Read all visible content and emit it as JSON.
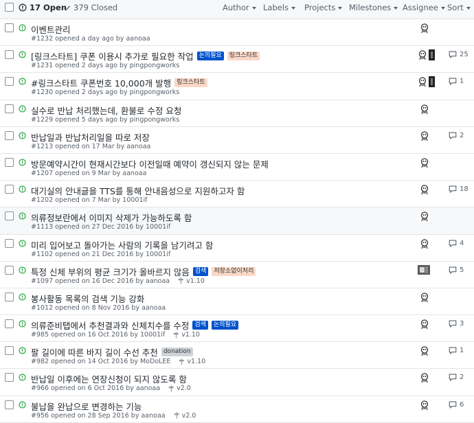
{
  "header": {
    "open_label": "17 Open",
    "closed_label": "379 Closed",
    "filters": [
      "Author",
      "Labels",
      "Projects",
      "Milestones",
      "Assignee",
      "Sort"
    ]
  },
  "colors": {
    "open_icon": "#28a745",
    "label_blue": "#0052cc",
    "label_peach": "#fad8c7",
    "label_gray": "#cfd3d7"
  },
  "issues": [
    {
      "title": "이벤트관리",
      "meta": "#1232 opened a day ago by aanoaa",
      "labels": [],
      "milestone": "",
      "comments": "",
      "avatar": "single"
    },
    {
      "title": "[링크스타트] 쿠폰 이용시 추가로 필요한 작업",
      "meta": "#1231 opened 2 days ago by pingpongworks",
      "labels": [
        {
          "text": "논의필요",
          "style": "blue"
        },
        {
          "text": "링크스타트",
          "style": "peach"
        }
      ],
      "milestone": "",
      "comments": "25",
      "avatar": "double"
    },
    {
      "title": "#링크스타트 쿠폰번호 10,000개 발행",
      "meta": "#1230 opened 2 days ago by pingpongworks",
      "labels": [
        {
          "text": "링크스타트",
          "style": "peach"
        }
      ],
      "milestone": "",
      "comments": "1",
      "avatar": "double"
    },
    {
      "title": "실수로 반납 처리했는데, 환불로 수정 요청",
      "meta": "#1229 opened 5 days ago by pingpongworks",
      "labels": [],
      "milestone": "",
      "comments": "",
      "avatar": "single"
    },
    {
      "title": "반납일과 반납처리일을 따로 저장",
      "meta": "#1213 opened on 17 Mar by aanoaa",
      "labels": [],
      "milestone": "",
      "comments": "2",
      "avatar": "single"
    },
    {
      "title": "방문예약시간이 현재시간보다 이전일때 예약이 갱신되지 않는 문제",
      "meta": "#1207 opened on 9 Mar by aanoaa",
      "labels": [],
      "milestone": "",
      "comments": "",
      "avatar": "single"
    },
    {
      "title": "대기실의 안내글을 TTS를 통해 안내음성으로 지원하고자 함",
      "meta": "#1202 opened on 7 Mar by 10001if",
      "labels": [],
      "milestone": "",
      "comments": "18",
      "avatar": "single"
    },
    {
      "title": "의류정보란에서 이미지 삭제가 가능하도록 함",
      "meta": "#1113 opened on 27 Dec 2016 by 10001if",
      "labels": [],
      "milestone": "",
      "comments": "",
      "avatar": "single"
    },
    {
      "title": "미리 입어보고 돌아가는 사람의 기록을 남기려고 함",
      "meta": "#1102 opened on 21 Dec 2016 by 10001if",
      "labels": [],
      "milestone": "",
      "comments": "4",
      "avatar": "single"
    },
    {
      "title": "특정 신체 부위의 평균 크기가 올바르지 않음",
      "meta": "#1097 opened on 16 Dec 2016 by aanoaa",
      "labels": [
        {
          "text": "검색",
          "style": "blue"
        },
        {
          "text": "저장소없이처리",
          "style": "peach"
        }
      ],
      "milestone": "v1.10",
      "comments": "5",
      "avatar": "big"
    },
    {
      "title": "봉사활동 목록의 검색 기능 강화",
      "meta": "#1012 opened on 8 Nov 2016 by aanoaa",
      "labels": [],
      "milestone": "",
      "comments": "",
      "avatar": "single"
    },
    {
      "title": "의류준비탭에서 추천결과와 신체치수를 수정",
      "meta": "#985 opened on 16 Oct 2016 by 10001if",
      "labels": [
        {
          "text": "검색",
          "style": "blue"
        },
        {
          "text": "논의필요",
          "style": "blue"
        }
      ],
      "milestone": "v1.10",
      "comments": "3",
      "avatar": "single"
    },
    {
      "title": "팔 길이에 따른 바지 길이 수선 추천",
      "meta": "#982 opened on 14 Oct 2016 by MoDoLEE",
      "labels": [
        {
          "text": "donation",
          "style": "gray"
        }
      ],
      "milestone": "v1.10",
      "comments": "1",
      "avatar": "single"
    },
    {
      "title": "반납일 이후에는 연장신청이 되지 않도록 함",
      "meta": "#966 opened on 6 Oct 2016 by aanoaa",
      "labels": [],
      "milestone": "v2.0",
      "comments": "2",
      "avatar": "single"
    },
    {
      "title": "불납을 완납으로 변경하는 기능",
      "meta": "#956 opened on 28 Sep 2016 by aanoaa",
      "labels": [],
      "milestone": "v2.0",
      "comments": "6",
      "avatar": "single"
    }
  ]
}
